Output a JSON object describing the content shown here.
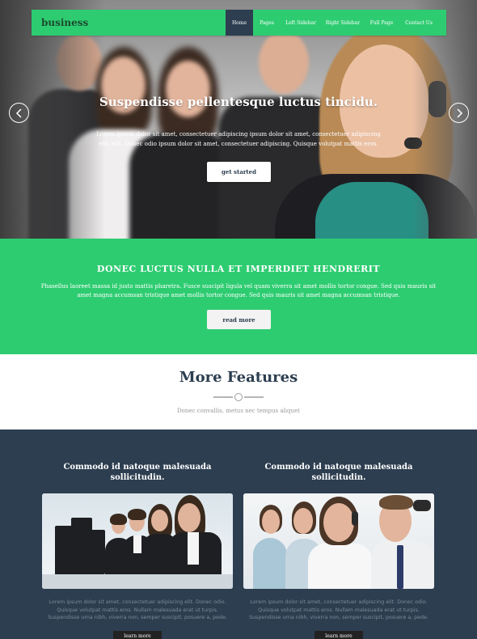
{
  "brand": {
    "logo": "business"
  },
  "nav": {
    "items": [
      {
        "label": "Home",
        "active": true
      },
      {
        "label": "Pages",
        "active": false
      },
      {
        "label": "Left Sidebar",
        "active": false
      },
      {
        "label": "Right Sidebar",
        "active": false
      },
      {
        "label": "Full Page",
        "active": false
      },
      {
        "label": "Contact Us",
        "active": false
      }
    ]
  },
  "hero": {
    "title": "Suspendisse pellentesque luctus tincidu.",
    "text": "Lorem ipsum dolor sit amet, consectetuer adipiscing ipsum dolor sit amet, consectetuer adipiscing elit. elit. Donec odio ipsum dolor sit amet, consectetuer adipiscing. Quisque volutpat mattis eros.",
    "button": "get started",
    "prev_icon": "chevron-left-icon",
    "next_icon": "chevron-right-icon"
  },
  "banner": {
    "title": "DONEC LUCTUS NULLA ET IMPERDIET HENDRERIT",
    "text": "Phasellus laoreet massa id justo mattis pharetra. Fusce suscipit ligula vel quam viverra sit amet mollis tortor congue. Sed quis mauris sit amet magna accumsan tristique amet mollis tortor congue. Sed quis mauris sit amet magna accumsan tristique.",
    "button": "read more"
  },
  "features": {
    "title": "More Features",
    "subtitle": "Donec convallis, metus nec tempus aliquet"
  },
  "cards": [
    {
      "title": "Commodo id natoque malesuada sollicitudin.",
      "text": "Lorem ipsum dolor sit amet, consectetuer adipiscing elit. Donec odio. Quisque volutpat mattis eros. Nullam malesuada erat ut turpis. Suspendisse urna nibh, viverra non, semper suscipit, posuere a, pede.",
      "button": "learn more"
    },
    {
      "title": "Commodo id natoque malesuada sollicitudin.",
      "text": "Lorem ipsum dolor sit amet, consectetuer adipiscing elit. Donec odio. Quisque volutpat mattis eros. Nullam malesuada erat ut turpis. Suspendisse urna nibh, viverra non, semper suscipit, posuere a, pede.",
      "button": "learn more"
    }
  ],
  "colors": {
    "accent_green": "#2ecc71",
    "dark_navy": "#2c3e50",
    "nav_active": "#2c3e50"
  }
}
